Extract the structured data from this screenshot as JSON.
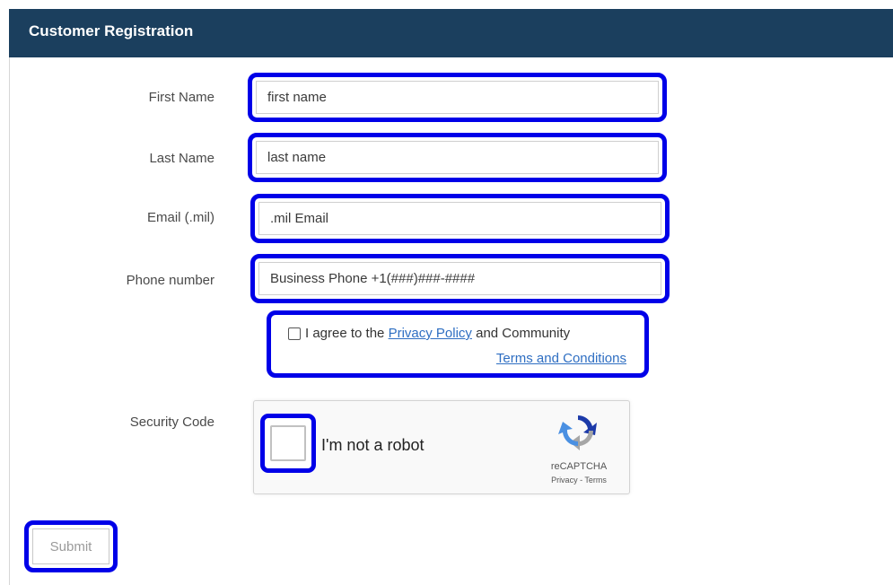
{
  "header": {
    "title": "Customer Registration"
  },
  "form": {
    "first_name": {
      "label": "First Name",
      "placeholder": "first name",
      "value": ""
    },
    "last_name": {
      "label": "Last Name",
      "placeholder": "last name",
      "value": ""
    },
    "email": {
      "label": "Email (.mil)",
      "placeholder": ".mil Email",
      "value": ""
    },
    "phone": {
      "label": "Phone number",
      "placeholder": "Business Phone +1(###)###-####",
      "value": ""
    },
    "agreement": {
      "prefix": "I agree to the",
      "privacy_link": "Privacy Policy",
      "middle": "and Community",
      "terms_link": "Terms and Conditions",
      "checked": false
    },
    "security": {
      "label": "Security Code",
      "captcha_text": "I'm not a robot",
      "brand": "reCAPTCHA",
      "privacy": "Privacy",
      "separator": " - ",
      "terms": "Terms",
      "checked": false
    },
    "submit_label": "Submit"
  },
  "colors": {
    "header_bg": "#1b3f5e",
    "highlight_border": "#0000e8",
    "link": "#2e6ec2"
  }
}
